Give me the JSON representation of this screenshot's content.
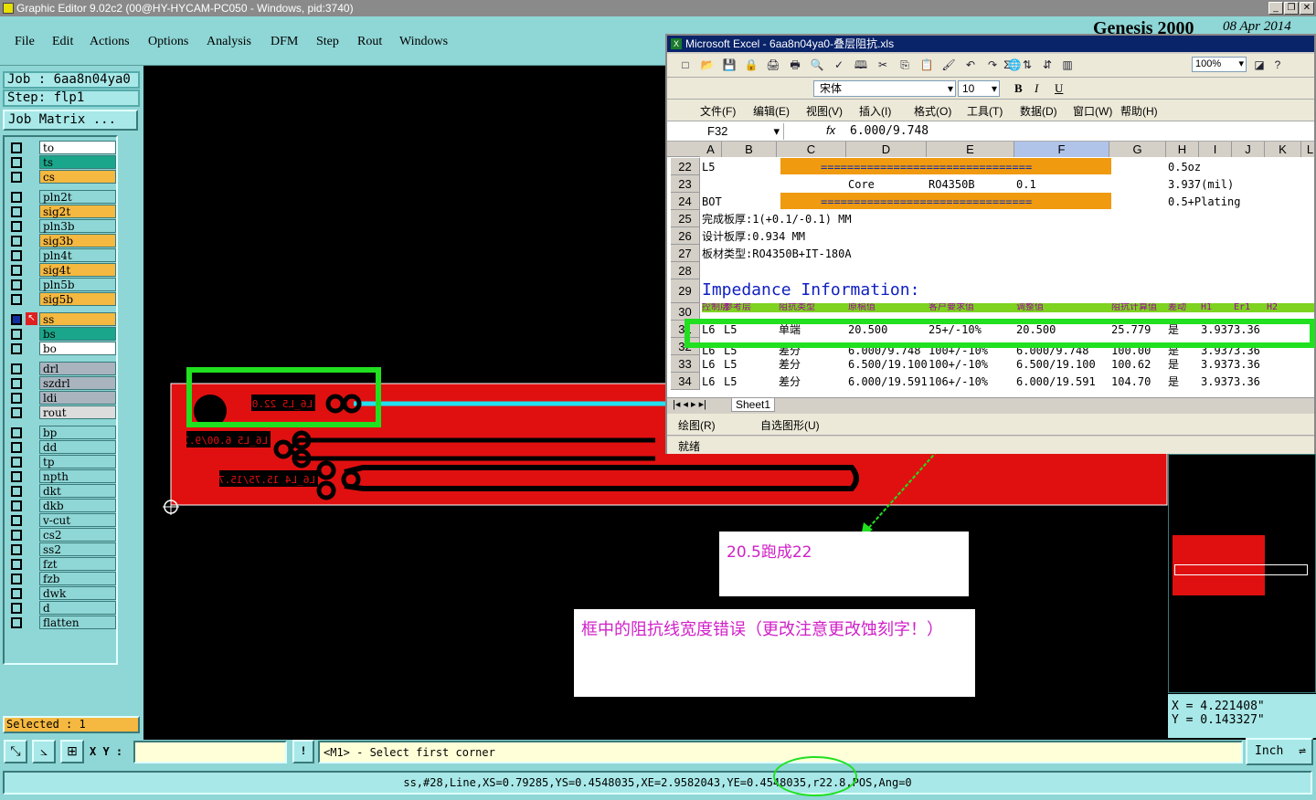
{
  "window": {
    "title": "Graphic Editor 9.02c2 (00@HY-HYCAM-PC050 - Windows, pid:3740)",
    "genesis_label": "Genesis 2000",
    "genesis_date": "08 Apr 2014"
  },
  "menu": [
    "File",
    "Edit",
    "Actions",
    "Options",
    "Analysis",
    "DFM",
    "Step",
    "Rout",
    "Windows"
  ],
  "job": {
    "job_label": "Job : 6aa8n04ya0",
    "step_label": "Step: flp1",
    "matrix_button": "Job Matrix ..."
  },
  "layers": [
    {
      "name": "to",
      "color": "#ffffff"
    },
    {
      "name": "ts",
      "color": "#1aa68a"
    },
    {
      "name": "cs",
      "color": "#f5b840"
    },
    {
      "name": "pln2t",
      "color": "#8fd6d6"
    },
    {
      "name": "sig2t",
      "color": "#f5b840"
    },
    {
      "name": "pln3b",
      "color": "#8fd6d6"
    },
    {
      "name": "sig3b",
      "color": "#f5b840"
    },
    {
      "name": "pln4t",
      "color": "#8fd6d6"
    },
    {
      "name": "sig4t",
      "color": "#f5b840"
    },
    {
      "name": "pln5b",
      "color": "#8fd6d6"
    },
    {
      "name": "sig5b",
      "color": "#f5b840"
    },
    {
      "name": "ss",
      "color": "#f5b840"
    },
    {
      "name": "bs",
      "color": "#1aa68a"
    },
    {
      "name": "bo",
      "color": "#ffffff"
    },
    {
      "name": "drl",
      "color": "#a9b4bf"
    },
    {
      "name": "szdrl",
      "color": "#a9b4bf"
    },
    {
      "name": "ldi",
      "color": "#a9b4bf"
    },
    {
      "name": "rout",
      "color": "#dcdcdc"
    },
    {
      "name": "bp",
      "color": "#8fd6d6"
    },
    {
      "name": "dd",
      "color": "#8fd6d6"
    },
    {
      "name": "tp",
      "color": "#8fd6d6"
    },
    {
      "name": "npth",
      "color": "#8fd6d6"
    },
    {
      "name": "dkt",
      "color": "#8fd6d6"
    },
    {
      "name": "dkb",
      "color": "#8fd6d6"
    },
    {
      "name": "v-cut",
      "color": "#8fd6d6"
    },
    {
      "name": "cs2",
      "color": "#8fd6d6"
    },
    {
      "name": "ss2",
      "color": "#8fd6d6"
    },
    {
      "name": "fzt",
      "color": "#8fd6d6"
    },
    {
      "name": "fzb",
      "color": "#8fd6d6"
    },
    {
      "name": "dwk",
      "color": "#8fd6d6"
    },
    {
      "name": "d",
      "color": "#8fd6d6"
    },
    {
      "name": "flatten",
      "color": "#8fd6d6"
    }
  ],
  "selected": "Selected : 1",
  "board_labels": [
    "L6_L5 22.00",
    "L6_L5 6.00/9.75",
    "L6_L4 15.75/15.75"
  ],
  "excel": {
    "title": "Microsoft Excel - 6aa8n04ya0-叠层阻抗.xls",
    "zoom": "100%",
    "font": "宋体",
    "font_size": "10",
    "menu": [
      "文件(F)",
      "编辑(E)",
      "视图(V)",
      "插入(I)",
      "格式(O)",
      "工具(T)",
      "数据(D)",
      "窗口(W)",
      "帮助(H)"
    ],
    "name_box": "F32",
    "formula": "6.000/9.748",
    "columns": [
      "A",
      "B",
      "C",
      "D",
      "E",
      "F",
      "G",
      "H",
      "I",
      "J",
      "K",
      "L"
    ],
    "rows": [
      {
        "num": "22",
        "cells": {
          "A": "L5",
          "C": "================================",
          "H": "0.5oz"
        }
      },
      {
        "num": "23",
        "cells": {
          "D": "Core",
          "E": "RO4350B",
          "F": "0.1",
          "H": "3.937(mil)"
        }
      },
      {
        "num": "24",
        "cells": {
          "A": "BOT",
          "C": "================================",
          "H": "0.5+Plating"
        }
      },
      {
        "num": "25",
        "cells": {
          "A": "完成板厚:1(+0.1/-0.1) MM"
        }
      },
      {
        "num": "26",
        "cells": {
          "A": "设计板厚:0.934 MM"
        }
      },
      {
        "num": "27",
        "cells": {
          "A": "板材类型:RO4350B+IT-180A"
        }
      },
      {
        "num": "28",
        "cells": {}
      },
      {
        "num": "29",
        "cells": {
          "A": "Impedance Information:"
        }
      },
      {
        "num": "30",
        "cells": {
          "A": "控制层",
          "B": "参考层",
          "C": "阻抗类型",
          "D": "原稿值",
          "E": "客户要求值",
          "F": "调整值",
          "G": "阻抗计算值",
          "H": "差动",
          "I": "H1",
          "J": "Er1",
          "K": "H2"
        }
      },
      {
        "num": "31",
        "cells": {
          "A": "L6",
          "B": "L5",
          "C": "单端",
          "D": "20.500",
          "E": "25+/-10%",
          "F": "20.500",
          "G": "25.779",
          "H": "是",
          "I": "3.937",
          "J": "3.36"
        }
      },
      {
        "num": "32",
        "cells": {
          "A": "L6",
          "B": "L5",
          "C": "差分",
          "D": "6.000/9.748",
          "E": "100+/-10%",
          "F": "6.000/9.748",
          "G": "100.00",
          "H": "是",
          "I": "3.937",
          "J": "3.36"
        }
      },
      {
        "num": "33",
        "cells": {
          "A": "L6",
          "B": "L5",
          "C": "差分",
          "D": "6.500/19.100",
          "E": "100+/-10%",
          "F": "6.500/19.100",
          "G": "100.62",
          "H": "是",
          "I": "3.937",
          "J": "3.36"
        }
      },
      {
        "num": "34",
        "cells": {
          "A": "L6",
          "B": "L5",
          "C": "差分",
          "D": "6.000/19.591",
          "E": "106+/-10%",
          "F": "6.000/19.591",
          "G": "104.70",
          "H": "是",
          "I": "3.937",
          "J": "3.36"
        }
      }
    ],
    "sheet_tab": "Sheet1",
    "draw_label": "绘图(R)",
    "autoshape_label": "自选图形(U)",
    "status": "就绪"
  },
  "annotations": {
    "note1": "20.5跑成22",
    "note2": "框中的阻抗线宽度错误（更改注意更改蚀刻字！）"
  },
  "coordinates": {
    "x": "X = 4.221408\"",
    "y": "Y = 0.143327\""
  },
  "command": {
    "xy_label": "X Y :",
    "input_value": "",
    "prompt": "<M1> - Select first corner",
    "unit": "Inch",
    "exclaim": "!"
  },
  "status_text": "ss,#28,Line,XS=0.79285,YS=0.4548035,XE=2.9582043,YE=0.4548035,r22.8,POS,Ang=0"
}
